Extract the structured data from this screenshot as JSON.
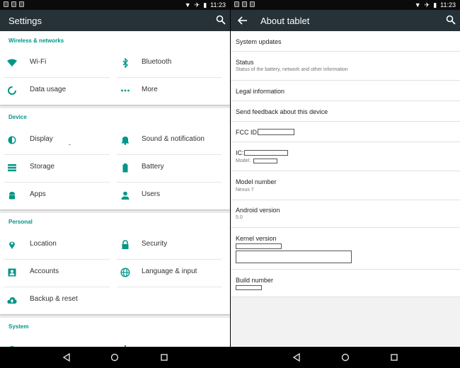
{
  "status_bar": {
    "time": "11:23"
  },
  "left": {
    "title": "Settings",
    "sections": [
      {
        "header": "Wireless & networks",
        "items": [
          {
            "label": "Wi-Fi",
            "icon": "wifi-icon"
          },
          {
            "label": "Bluetooth",
            "icon": "bluetooth-icon"
          },
          {
            "label": "Data usage",
            "icon": "data-usage-icon"
          },
          {
            "label": "More",
            "icon": "more-icon"
          }
        ]
      },
      {
        "header": "Device",
        "items": [
          {
            "label": "Display",
            "icon": "display-icon"
          },
          {
            "label": "Sound & notification",
            "icon": "bell-icon"
          },
          {
            "label": "Storage",
            "icon": "storage-icon"
          },
          {
            "label": "Battery",
            "icon": "battery-icon"
          },
          {
            "label": "Apps",
            "icon": "android-icon"
          },
          {
            "label": "Users",
            "icon": "user-icon"
          }
        ]
      },
      {
        "header": "Personal",
        "items": [
          {
            "label": "Location",
            "icon": "location-icon"
          },
          {
            "label": "Security",
            "icon": "lock-icon"
          },
          {
            "label": "Accounts",
            "icon": "account-icon"
          },
          {
            "label": "Language & input",
            "icon": "globe-icon"
          },
          {
            "label": "Backup & reset",
            "icon": "cloud-upload-icon"
          }
        ]
      },
      {
        "header": "System",
        "items": []
      }
    ]
  },
  "right": {
    "title": "About tablet",
    "items": {
      "system_updates": {
        "title": "System updates"
      },
      "status": {
        "title": "Status",
        "sub": "Status of the battery, network and other information"
      },
      "legal": {
        "title": "Legal information"
      },
      "feedback": {
        "title": "Send feedback about this device"
      },
      "fcc": {
        "title": "FCC ID:"
      },
      "ic": {
        "title": "IC:",
        "sub": "Model:"
      },
      "model": {
        "title": "Model number",
        "sub": "Nexus 7"
      },
      "android": {
        "title": "Android version",
        "sub": "5.0"
      },
      "kernel": {
        "title": "Kernel version"
      },
      "build": {
        "title": "Build number"
      }
    }
  },
  "colors": {
    "app_bar": "#263238",
    "accent": "#009688",
    "icon": "#009688"
  }
}
